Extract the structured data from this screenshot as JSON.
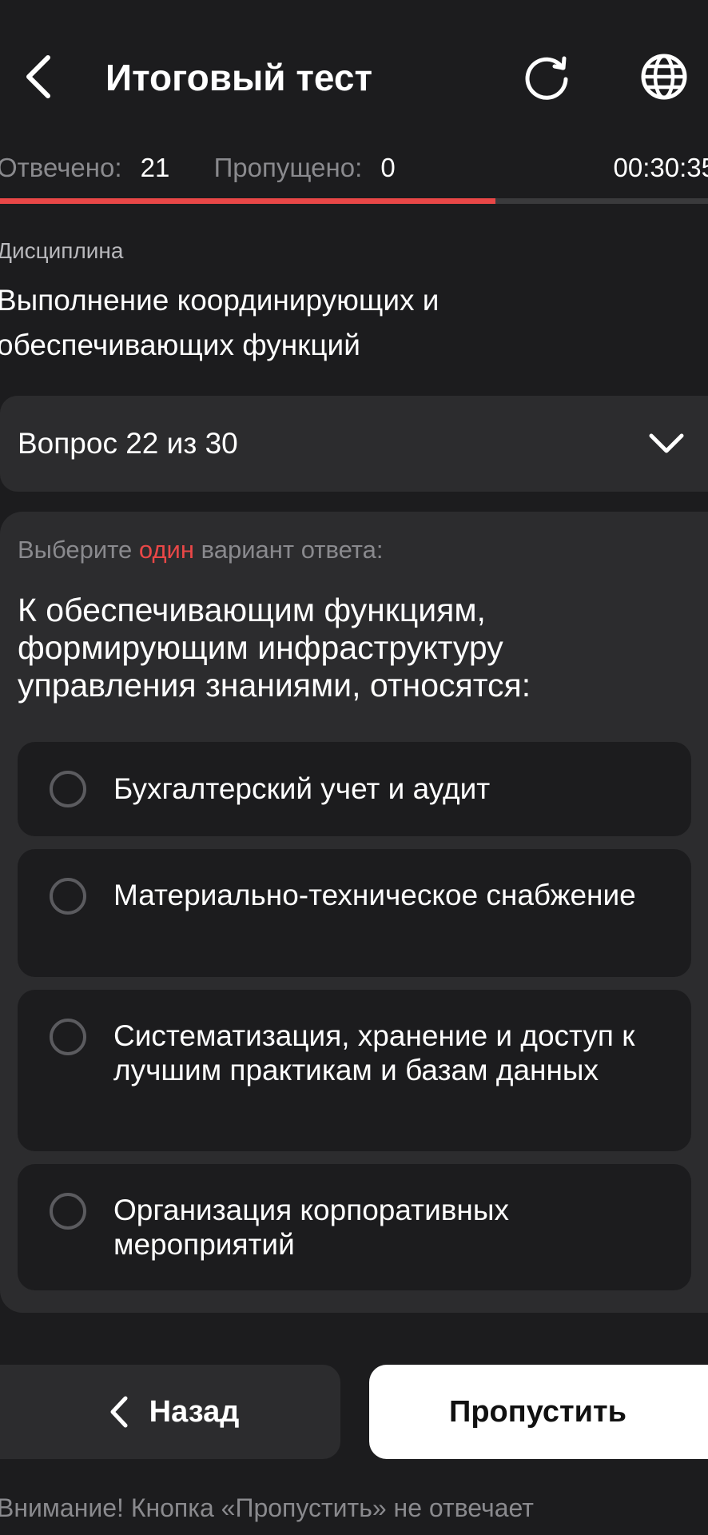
{
  "header": {
    "title": "Итоговый тест",
    "icons": {
      "back": "chevron-left-icon",
      "refresh": "refresh-icon",
      "language": "globe-icon"
    }
  },
  "stats": {
    "answered_label": "Отвечено:",
    "answered_value": "21",
    "skipped_label": "Пропущено:",
    "skipped_value": "0",
    "timer": "00:30:35"
  },
  "progress": {
    "fraction": 0.7,
    "color": "#e94747"
  },
  "discipline": {
    "label": "Дисциплина",
    "title": "Выполнение координирующих и обеспечивающих функций"
  },
  "question_selector": {
    "label": "Вопрос 22 из 30",
    "icon": "chevron-down-icon"
  },
  "question": {
    "instruction_before": "Выберите",
    "instruction_accent": "один",
    "instruction_after": "вариант ответа:",
    "text": "К обеспечивающим функциям, формирующим инфраструктуру управления знаниями, относятся:",
    "answers": [
      {
        "label": "Бухгалтерский учет и аудит"
      },
      {
        "label": "Материально-техническое снабжение"
      },
      {
        "label": "Систематизация, хранение и доступ к лучшим практикам и базам данных"
      },
      {
        "label": "Организация корпоративных мероприятий"
      }
    ]
  },
  "buttons": {
    "back_label": "Назад",
    "skip_label": "Пропустить"
  },
  "warning": "Внимание! Кнопка «Пропустить» не отвечает",
  "colors": {
    "background": "#1c1c1e",
    "card": "#2c2c2e",
    "accent": "#e94747"
  }
}
